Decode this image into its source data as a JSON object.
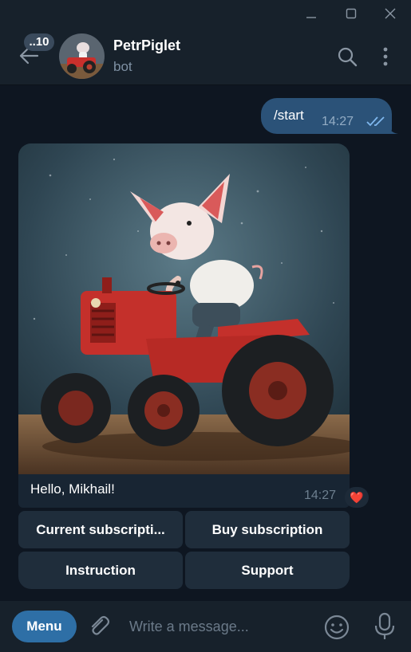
{
  "window": {
    "controls": [
      "minimize-icon",
      "maximize-icon",
      "close-icon"
    ]
  },
  "header": {
    "unread_badge": "..10",
    "title": "PetrPiglet",
    "subtitle": "bot",
    "icons": [
      "back-arrow-icon",
      "search-icon",
      "more-vertical-icon"
    ]
  },
  "messages": {
    "outgoing": {
      "text": "/start",
      "time": "14:27",
      "status_icon": "double-check-icon"
    },
    "incoming": {
      "image_icon": "pig-on-red-tractor-photo",
      "text": "Hello, Mikhail!",
      "time": "14:27",
      "reaction": "❤️"
    }
  },
  "keyboard": {
    "buttons": [
      {
        "label": "Current subscripti..."
      },
      {
        "label": "Buy subscription"
      },
      {
        "label": "Instruction"
      },
      {
        "label": "Support"
      }
    ]
  },
  "composer": {
    "menu_label": "Menu",
    "placeholder": "Write a message...",
    "icons": [
      "attach-icon",
      "emoji-icon",
      "microphone-icon"
    ]
  },
  "colors": {
    "background": "#0e1621",
    "panel": "#17212b",
    "outgoing_bubble": "#2b5278",
    "incoming_bubble": "#182533",
    "menu_button": "#2e6fa6",
    "accent": "#5eb5f7"
  }
}
